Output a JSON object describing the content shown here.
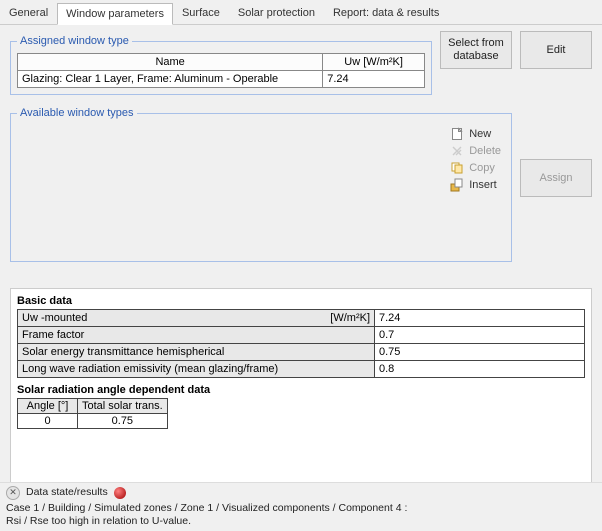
{
  "tabs": {
    "general": "General",
    "window_params": "Window parameters",
    "surface": "Surface",
    "solar_protection": "Solar protection",
    "report": "Report: data & results"
  },
  "assigned": {
    "legend": "Assigned window type",
    "name_header": "Name",
    "uw_header": "Uw [W/m²K]",
    "name_value": "Glazing: Clear 1 Layer, Frame: Aluminum - Operable",
    "uw_value": "7.24"
  },
  "buttons": {
    "select_from_db": "Select from database",
    "edit": "Edit",
    "assign": "Assign"
  },
  "available": {
    "legend": "Available window types",
    "actions": {
      "new": "New",
      "delete": "Delete",
      "copy": "Copy",
      "insert": "Insert"
    }
  },
  "basic": {
    "title": "Basic data",
    "uw_label": "Uw -mounted",
    "uw_unit": "[W/m²K]",
    "uw_val": "7.24",
    "frame_label": "Frame factor",
    "frame_val": "0.7",
    "solar_trans_label": "Solar energy transmittance hemispherical",
    "solar_trans_val": "0.75",
    "emissivity_label": "Long wave radiation emissivity (mean glazing/frame)",
    "emissivity_val": "0.8"
  },
  "angle": {
    "title": "Solar radiation angle dependent data",
    "col1": "Angle [°]",
    "col2": "Total solar trans.",
    "row_angle": "0",
    "row_trans": "0.75"
  },
  "status": {
    "heading": "Data state/results",
    "breadcrumb": "Case 1 / Building / Simulated zones / Zone 1 / Visualized components / Component 4 :",
    "message": "Rsi / Rse too high in relation to U-value."
  }
}
